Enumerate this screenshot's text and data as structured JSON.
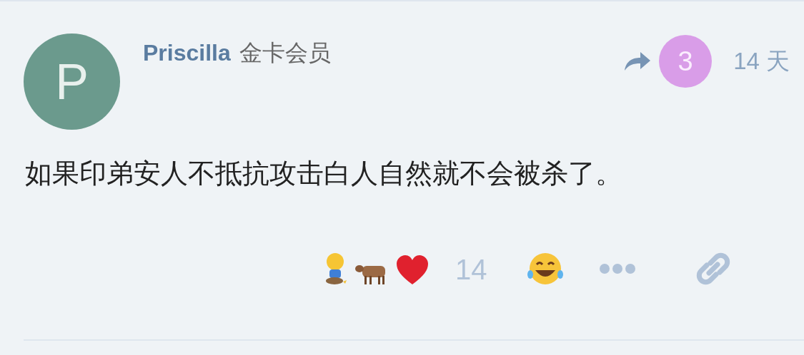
{
  "post": {
    "avatar_letter": "P",
    "author": "Priscilla",
    "badge": "金卡会员",
    "reply_count": "3",
    "age": "14 天",
    "body": "如果印弟安人不抵抗攻击白人自然就不会被杀了。"
  },
  "reactions": {
    "count": "14"
  }
}
